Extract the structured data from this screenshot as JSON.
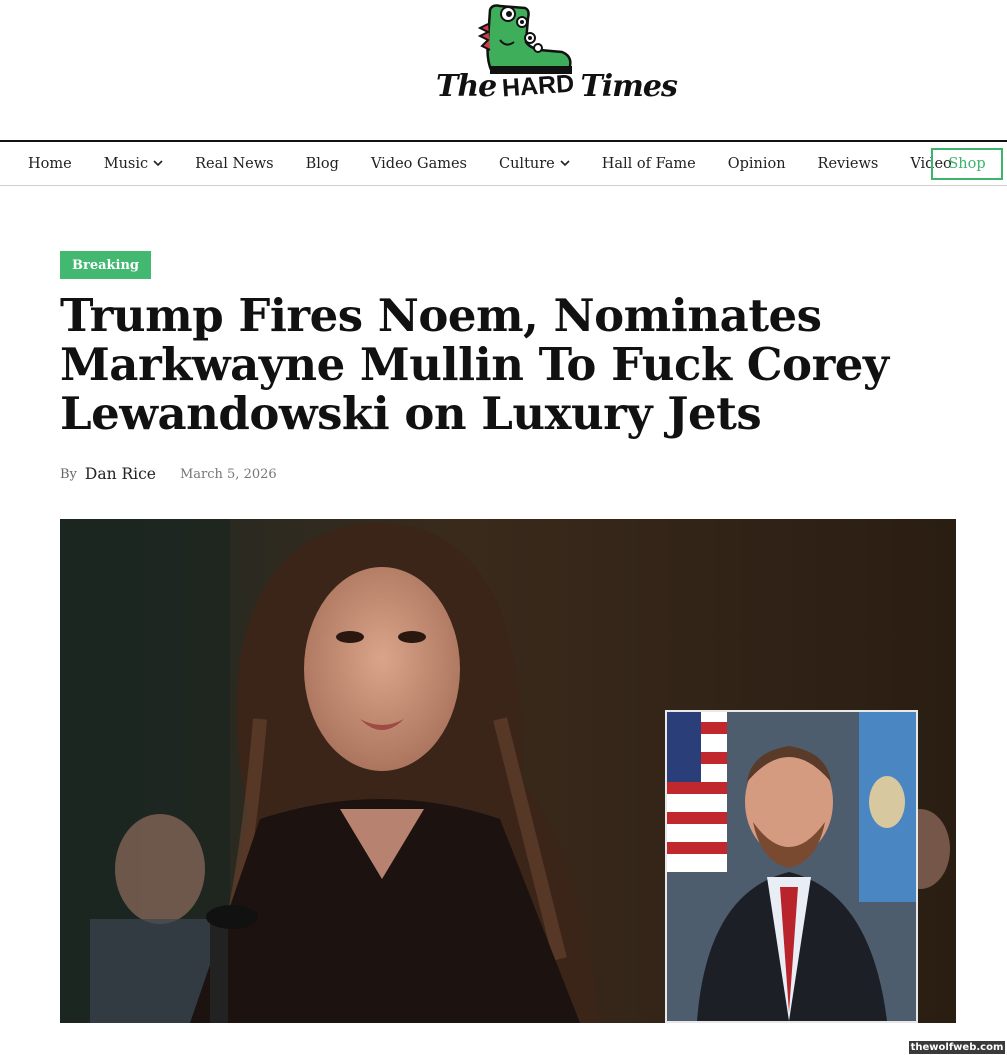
{
  "site": {
    "logo": {
      "word_the": "The",
      "word_hard": "HARD",
      "word_times": "Times"
    }
  },
  "nav": {
    "items": [
      {
        "label": "Home",
        "dropdown": false
      },
      {
        "label": "Music",
        "dropdown": true
      },
      {
        "label": "Real News",
        "dropdown": false
      },
      {
        "label": "Blog",
        "dropdown": false
      },
      {
        "label": "Video Games",
        "dropdown": false
      },
      {
        "label": "Culture",
        "dropdown": true
      },
      {
        "label": "Hall of Fame",
        "dropdown": false
      },
      {
        "label": "Opinion",
        "dropdown": false
      },
      {
        "label": "Reviews",
        "dropdown": false
      },
      {
        "label": "Video",
        "dropdown": false
      }
    ],
    "shop_label": "Shop"
  },
  "article": {
    "category": "Breaking",
    "headline": "Trump Fires Noem, Nominates Markwayne Mullin To Fuck Corey Lewandowski on Luxury Jets",
    "by_label": "By",
    "author": "Dan Rice",
    "date": "March 5, 2026"
  },
  "watermark": "thewolfweb.com",
  "colors": {
    "accent": "#42b870",
    "text": "#111111"
  },
  "icons": {
    "dropdown": "chevron-down-icon",
    "logo_mascot": "boot-monster-icon"
  }
}
